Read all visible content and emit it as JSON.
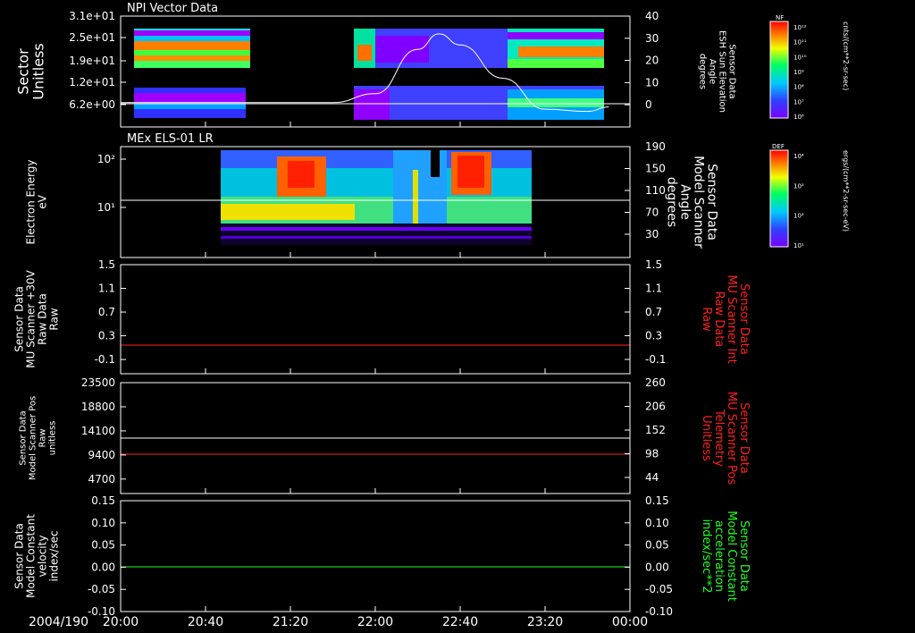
{
  "chart_data": [
    {
      "type": "heatmap",
      "title": "NPI Vector Data",
      "ylabel_lines": [
        "Sector",
        "Unitless"
      ],
      "y_ticks": [
        "3.1e+01",
        "2.5e+01",
        "1.9e+01",
        "1.2e+01",
        "6.2e+00"
      ],
      "right_ticks": [
        "40",
        "30",
        "20",
        "10",
        "0"
      ],
      "right_label_lines": [
        "Sensor Data",
        "ESH Sun Elevation",
        "Angle",
        "degrees"
      ],
      "ylim_right": [
        -10,
        40
      ],
      "overlay_line": {
        "name": "ESH Sun Elevation Angle",
        "x": [
          "20:00",
          "20:40",
          "21:20",
          "21:40",
          "22:00",
          "22:20",
          "22:30",
          "22:40",
          "23:00",
          "23:20",
          "23:40",
          "23:50"
        ],
        "y": [
          1,
          1,
          1,
          1,
          5,
          25,
          32,
          27,
          12,
          -2,
          -3,
          -1
        ]
      },
      "data_spans": [
        [
          "20:10",
          "21:00"
        ],
        [
          "21:45",
          "23:50"
        ]
      ]
    },
    {
      "type": "heatmap",
      "title": "MEx ELS-01 LR",
      "ylabel_lines": [
        "Electron Energy",
        "eV"
      ],
      "y_ticks": [
        "10²",
        "10¹"
      ],
      "y_scale": "log",
      "right_ticks": [
        "190",
        "150",
        "110",
        "70",
        "30"
      ],
      "right_label_lines": [
        "Sensor Data",
        "Model Scanner",
        "Angle",
        "degrees"
      ],
      "overlay_line": {
        "name": "Model Scanner Angle",
        "value": 90
      },
      "data_span": [
        "20:48",
        "23:15"
      ]
    },
    {
      "type": "line",
      "ylabel_lines": [
        "Sensor Data",
        "MU Scanner +30V",
        "Raw Data",
        "Raw"
      ],
      "y_ticks": [
        "1.5",
        "1.1",
        "0.7",
        "0.3",
        "-0.1"
      ],
      "right_ticks": [
        "1.5",
        "1.1",
        "0.7",
        "0.3",
        "-0.1"
      ],
      "right_label_lines": [
        "Sensor Data",
        "MU Scanner Int",
        "Raw Data",
        "Raw"
      ],
      "ylim": [
        -0.5,
        1.5
      ],
      "series": [
        {
          "color": "#ff2020",
          "value": 0.1
        }
      ]
    },
    {
      "type": "line",
      "ylabel_lines": [
        "Sensor Data",
        "Model Scanner Pos",
        "Raw",
        "unitless"
      ],
      "y_ticks": [
        "23500",
        "18800",
        "14100",
        "9400",
        "4700"
      ],
      "right_ticks": [
        "260",
        "206",
        "152",
        "98",
        "44"
      ],
      "right_label_lines": [
        "Sensor Data",
        "MU Scanner Pos",
        "Telemetry",
        "Unitless"
      ],
      "ylim": [
        0,
        23500
      ],
      "ylim_right": [
        -10,
        260
      ],
      "series": [
        {
          "color": "#ffffff",
          "value": 11400
        },
        {
          "color": "#ff2020",
          "value": 8300
        }
      ]
    },
    {
      "type": "line",
      "ylabel_lines": [
        "Sensor Data",
        "Model Constant",
        "velocity",
        "index/sec"
      ],
      "y_ticks": [
        "0.15",
        "0.10",
        "0.05",
        "0.00",
        "-0.05",
        "-0.10"
      ],
      "right_ticks": [
        "0.15",
        "0.10",
        "0.05",
        "0.00",
        "-0.05",
        "-0.10"
      ],
      "right_label_lines": [
        "Sensor Data",
        "Model Constant",
        "acceleration",
        "index/sec**2"
      ],
      "ylim": [
        -0.1,
        0.15
      ],
      "series": [
        {
          "color": "#20ff20",
          "value": 0.0
        }
      ]
    }
  ],
  "x_axis": {
    "date": "2004/190",
    "ticks": [
      "20:00",
      "20:40",
      "21:20",
      "22:00",
      "22:40",
      "23:20",
      "00:00"
    ]
  },
  "colorbars": [
    {
      "tag": "NF",
      "units": "cnts/(cm**2-sr-sec)",
      "ticks": [
        "10¹²",
        "10¹¹",
        "10¹⁰",
        "10⁹",
        "10⁸",
        "10⁷",
        "10⁶"
      ]
    },
    {
      "tag": "DEF",
      "units": "ergs/(cm**2-sr-sec-eV)",
      "ticks": [
        "10⁴",
        "10³",
        "10²",
        "10¹"
      ]
    }
  ]
}
